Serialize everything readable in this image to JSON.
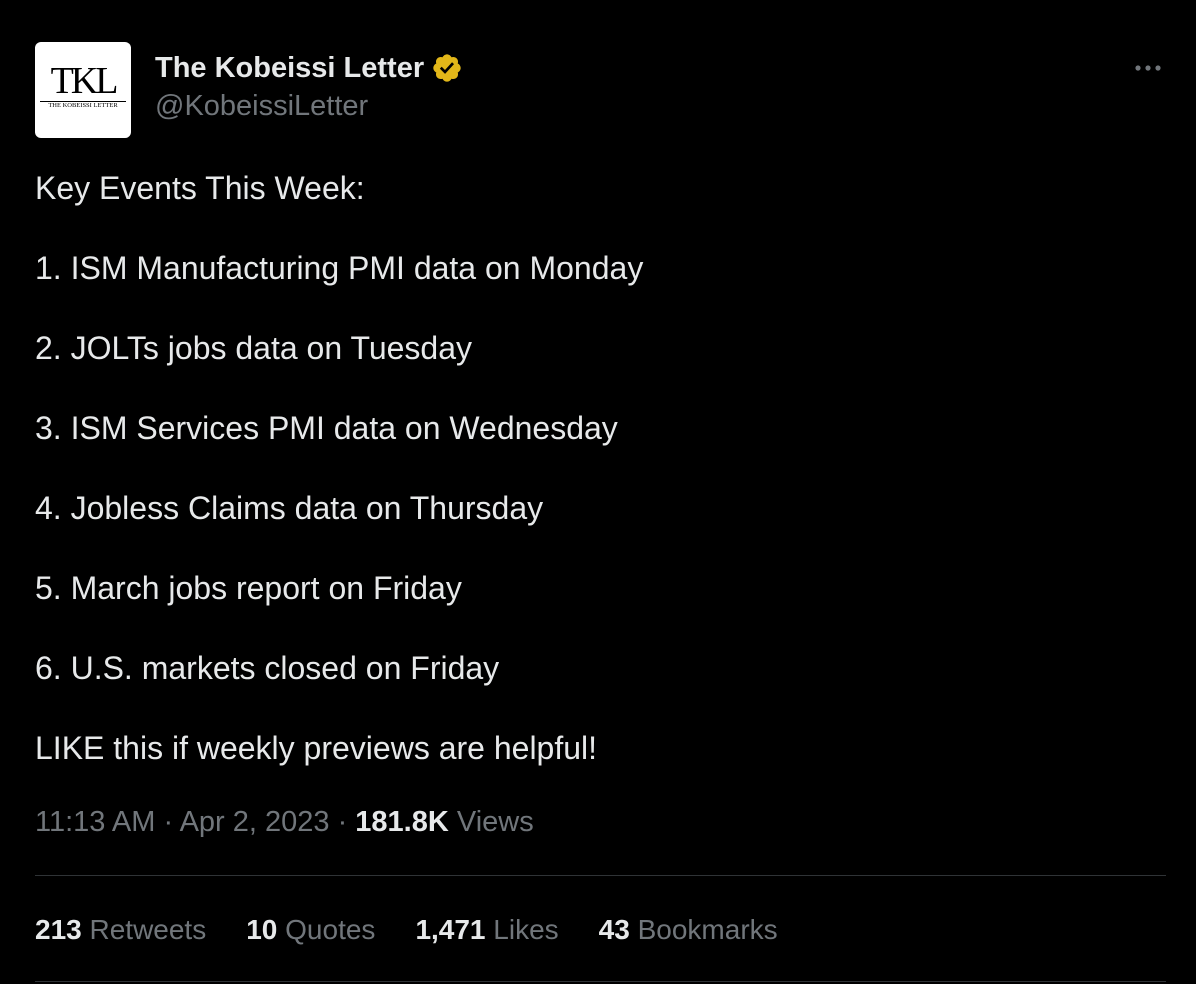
{
  "author": {
    "display_name": "The Kobeissi Letter",
    "handle": "@KobeissiLetter",
    "avatar_monogram": "TKL",
    "avatar_caption": "THE KOBEISSI LETTER",
    "verified_icon": "verified-badge-icon",
    "verified_color": "#e2b719"
  },
  "more_icon": "more-horizontal-icon",
  "tweet": {
    "lines": [
      "Key Events This Week:",
      "1. ISM Manufacturing PMI data on Monday",
      "2. JOLTs jobs data on Tuesday",
      "3. ISM Services PMI data on Wednesday",
      "4. Jobless Claims data on Thursday",
      "5. March jobs report on Friday",
      "6. U.S. markets closed on Friday",
      "LIKE this if weekly previews are helpful!"
    ]
  },
  "meta": {
    "time": "11:13 AM",
    "sep1": " · ",
    "date": "Apr 2, 2023",
    "sep2": " · ",
    "views_count": "181.8K",
    "views_label": " Views"
  },
  "stats": {
    "retweets": {
      "count": "213",
      "label": " Retweets"
    },
    "quotes": {
      "count": "10",
      "label": " Quotes"
    },
    "likes": {
      "count": "1,471",
      "label": " Likes"
    },
    "bookmarks": {
      "count": "43",
      "label": " Bookmarks"
    }
  },
  "colors": {
    "background": "#000000",
    "text": "#e7e9ea",
    "secondary_text": "#71767b",
    "divider": "#2f3336"
  }
}
